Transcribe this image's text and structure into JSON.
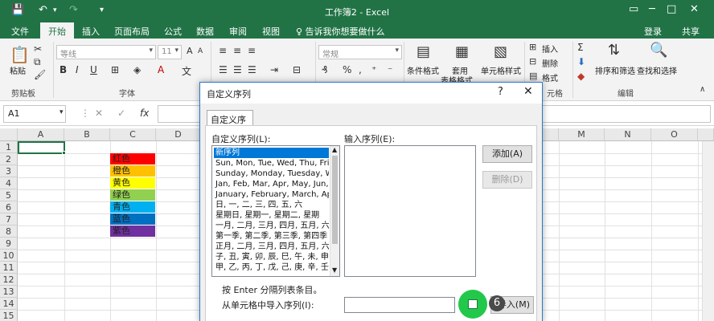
{
  "window": {
    "title": "工作簿2 - Excel",
    "quick_access": [
      "save-icon",
      "undo-icon",
      "redo-icon",
      "customize-icon"
    ],
    "controls": [
      "ribbon-options-icon",
      "minimize-icon",
      "maximize-icon",
      "close-icon"
    ]
  },
  "tabs": [
    "文件",
    "开始",
    "插入",
    "页面布局",
    "公式",
    "数据",
    "审阅",
    "视图"
  ],
  "active_tab": "开始",
  "tell_me": "♀ 告诉我你想要做什么",
  "account": {
    "login": "登录",
    "share": "共享"
  },
  "ribbon": {
    "paste": "粘贴",
    "clipboard": "剪贴板",
    "font_name": "等线",
    "font_size": "11",
    "font_group": "字体",
    "number_format": "常规",
    "conditional_format": "条件格式",
    "format_as_table_1": "套用",
    "format_as_table_2": "表格格式",
    "cell_styles": "单元格样式",
    "insert": "插入",
    "delete": "删除",
    "format": "格式",
    "cells_group": "元格",
    "sort_filter": "排序和筛选",
    "find_select": "查找和选择",
    "editing_group": "编辑"
  },
  "formula_bar": {
    "name_box": "A1",
    "fx": "fx"
  },
  "grid": {
    "columns": [
      "A",
      "B",
      "C",
      "D",
      "M",
      "N",
      "O"
    ],
    "rows": [
      "1",
      "2",
      "3",
      "4",
      "5",
      "6",
      "7",
      "8",
      "9",
      "10",
      "11",
      "12",
      "13",
      "14",
      "15"
    ],
    "color_cells": [
      {
        "text": "红色",
        "color": "#ff0000"
      },
      {
        "text": "橙色",
        "color": "#ffc000"
      },
      {
        "text": "黄色",
        "color": "#ffff00"
      },
      {
        "text": "绿色",
        "color": "#92d050"
      },
      {
        "text": "青色",
        "color": "#00b0f0"
      },
      {
        "text": "蓝色",
        "color": "#0070c0"
      },
      {
        "text": "紫色",
        "color": "#7030a0"
      }
    ]
  },
  "dialog": {
    "title": "自定义序列",
    "help": "?",
    "close": "✕",
    "tab": "自定义序列",
    "list_label": "自定义序列(L):",
    "entries_label": "输入序列(E):",
    "list_items": [
      "新序列",
      "Sun, Mon, Tue, Wed, Thu, Fri, S",
      "Sunday, Monday, Tuesday, Wed",
      "Jan, Feb, Mar, Apr, May, Jun, J",
      "January, February, March, April",
      "日, 一, 二, 三, 四, 五, 六",
      "星期日, 星期一, 星期二, 星期",
      "一月, 二月, 三月, 四月, 五月, 六月,",
      "第一季, 第二季, 第三季, 第四季",
      "正月, 二月, 三月, 四月, 五月, 六月,",
      "子, 丑, 寅, 卯, 辰, 巳, 午, 未, 申, 酉",
      "甲, 乙, 丙, 丁, 戊, 己, 庚, 辛, 壬, 癸"
    ],
    "add_button": "添加(A)",
    "delete_button": "删除(D)",
    "hint": "按 Enter 分隔列表条目。",
    "import_label": "从单元格中导入序列(I):",
    "import_button": "导入(M)",
    "step_badge": "6"
  }
}
